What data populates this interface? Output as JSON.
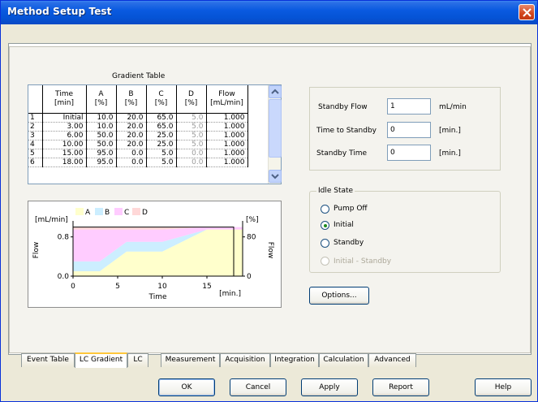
{
  "window": {
    "title": "Method Setup Test"
  },
  "gradient_table": {
    "caption": "Gradient Table",
    "columns": [
      {
        "line1": "Time",
        "line2": "[min]"
      },
      {
        "line1": "A",
        "line2": "[%]"
      },
      {
        "line1": "B",
        "line2": "[%]"
      },
      {
        "line1": "C",
        "line2": "[%]"
      },
      {
        "line1": "D",
        "line2": "[%]"
      },
      {
        "line1": "Flow",
        "line2": "[mL/min]"
      }
    ],
    "rows": [
      {
        "n": "1",
        "time": "Initial",
        "a": "10.0",
        "b": "20.0",
        "c": "65.0",
        "d": "5.0",
        "flow": "1.000"
      },
      {
        "n": "2",
        "time": "3.00",
        "a": "10.0",
        "b": "20.0",
        "c": "65.0",
        "d": "5.0",
        "flow": "1.000"
      },
      {
        "n": "3",
        "time": "6.00",
        "a": "50.0",
        "b": "20.0",
        "c": "25.0",
        "d": "5.0",
        "flow": "1.000"
      },
      {
        "n": "4",
        "time": "10.00",
        "a": "50.0",
        "b": "20.0",
        "c": "25.0",
        "d": "5.0",
        "flow": "1.000"
      },
      {
        "n": "5",
        "time": "15.00",
        "a": "95.0",
        "b": "0.0",
        "c": "5.0",
        "d": "0.0",
        "flow": "1.000"
      },
      {
        "n": "6",
        "time": "18.00",
        "a": "95.0",
        "b": "0.0",
        "c": "5.0",
        "d": "0.0",
        "flow": "1.000"
      }
    ]
  },
  "chart_data": {
    "type": "area",
    "legend": [
      "A",
      "B",
      "C",
      "D"
    ],
    "colors": {
      "A": "#ffffcc",
      "B": "#cceeff",
      "C": "#ffccff",
      "D": "#ffd8d8",
      "flow": "#000000"
    },
    "x": [
      0,
      3,
      6,
      10,
      15,
      18
    ],
    "series": [
      {
        "name": "A",
        "values": [
          10,
          10,
          50,
          50,
          95,
          95
        ]
      },
      {
        "name": "B",
        "values": [
          20,
          20,
          20,
          20,
          0,
          0
        ]
      },
      {
        "name": "C",
        "values": [
          65,
          65,
          25,
          25,
          5,
          5
        ]
      },
      {
        "name": "D",
        "values": [
          5,
          5,
          5,
          5,
          0,
          0
        ]
      }
    ],
    "flow": {
      "x": [
        0,
        18
      ],
      "values": [
        1.0,
        1.0
      ]
    },
    "xlabel": "Time",
    "xunit": "[min.]",
    "ylabel_left": "Flow",
    "yunit_left": "[mL/min]",
    "ylabel_right": "Flow",
    "yunit_right": "[%]",
    "xticks": [
      "0",
      "5",
      "10",
      "15"
    ],
    "xlim": [
      0,
      19
    ],
    "yticks_left": [
      "0.0",
      "0.8"
    ],
    "ylim_left": [
      0,
      1.06
    ],
    "yticks_right": [
      "0",
      "80"
    ],
    "ylim_right": [
      0,
      106
    ]
  },
  "standby": {
    "flow_label": "Standby Flow",
    "flow_value": "1",
    "flow_unit": "mL/min",
    "time_to_label": "Time to Standby",
    "time_to_value": "0",
    "time_to_unit": "[min.]",
    "time_label": "Standby Time",
    "time_value": "0",
    "time_unit": "[min.]"
  },
  "idle_state": {
    "title": "Idle State",
    "options": [
      {
        "label": "Pump Off",
        "checked": false,
        "disabled": false
      },
      {
        "label": "Initial",
        "checked": true,
        "disabled": false
      },
      {
        "label": "Standby",
        "checked": false,
        "disabled": false
      },
      {
        "label": "Initial - Standby",
        "checked": false,
        "disabled": true
      }
    ]
  },
  "options_button": "Options...",
  "tabs": [
    "Event Table",
    "LC Gradient",
    "LC",
    "Measurement",
    "Acquisition",
    "Integration",
    "Calculation",
    "Advanced"
  ],
  "active_tab": "LC Gradient",
  "buttons": {
    "ok": "OK",
    "cancel": "Cancel",
    "apply": "Apply",
    "report": "Report",
    "help": "Help"
  }
}
